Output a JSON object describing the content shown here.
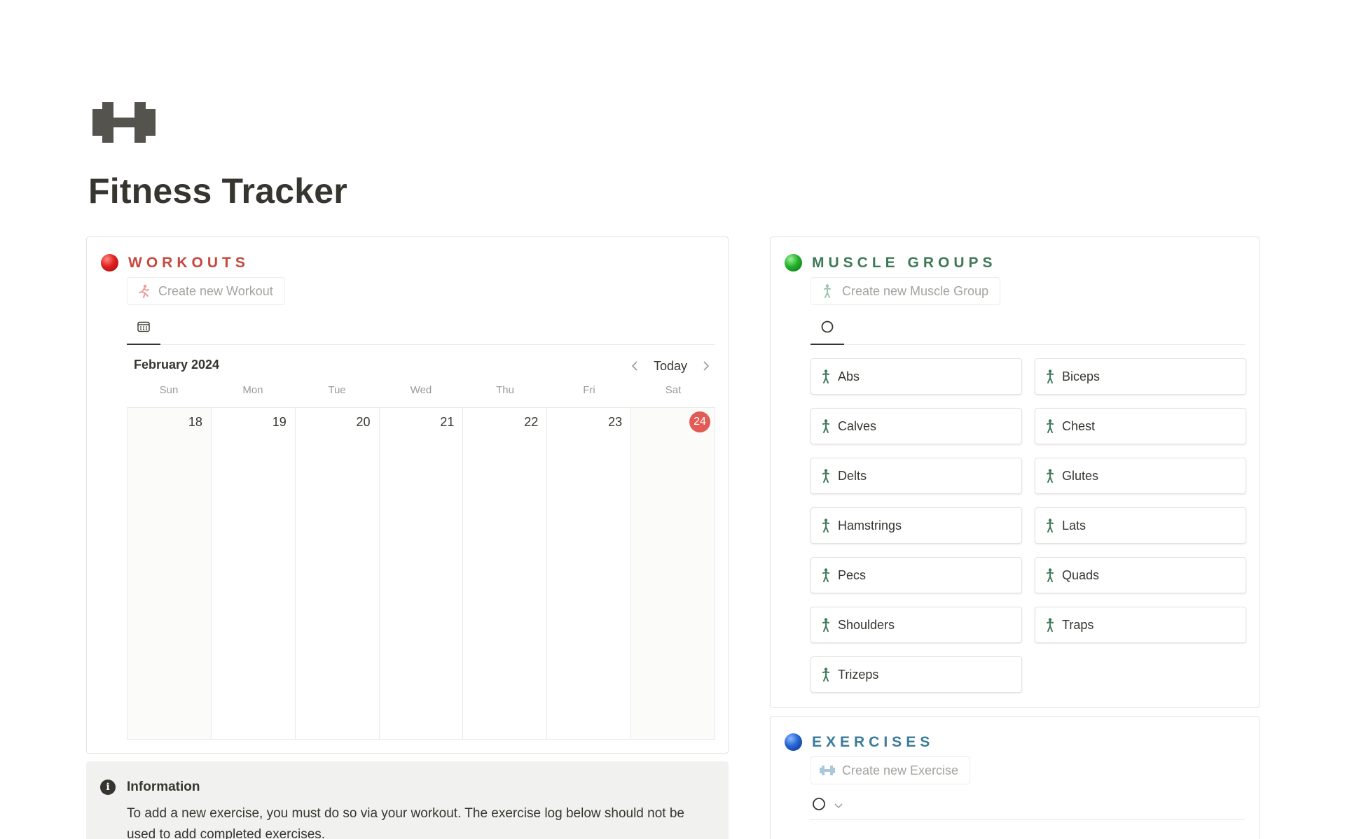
{
  "page": {
    "icon": "dumbbell-icon",
    "title": "Fitness Tracker"
  },
  "workouts": {
    "title": "WORKOUTS",
    "orb_color": "#e02020",
    "title_color": "#c5473e",
    "create_label": "Create new Workout",
    "create_icon": "running-figure-icon",
    "view_icon": "calendar-icon",
    "calendar": {
      "month": "February 2024",
      "today_label": "Today",
      "weekdays": [
        "Sun",
        "Mon",
        "Tue",
        "Wed",
        "Thu",
        "Fri",
        "Sat"
      ],
      "days": [
        "18",
        "19",
        "20",
        "21",
        "22",
        "23",
        "24"
      ],
      "today_day": "24",
      "today_color": "#e25b55"
    }
  },
  "info": {
    "title": "Information",
    "text": "To add a new exercise, you must do so via your workout. The exercise log below should not be used to add completed exercises."
  },
  "muscle_groups": {
    "title": "MUSCLE GROUPS",
    "orb_color": "#22b22a",
    "title_color": "#3e7a57",
    "create_label": "Create new Muscle Group",
    "create_icon": "standing-figure-icon",
    "view_icon": "circle-icon",
    "items": [
      "Abs",
      "Biceps",
      "Calves",
      "Chest",
      "Delts",
      "Glutes",
      "Hamstrings",
      "Lats",
      "Pecs",
      "Quads",
      "Shoulders",
      "Traps",
      "Trizeps"
    ]
  },
  "exercises": {
    "title": "EXERCISES",
    "orb_color": "#2565d6",
    "title_color": "#3a7a9a",
    "create_label": "Create new Exercise",
    "create_icon": "dumbbell-icon",
    "view_icon": "circle-icon"
  }
}
